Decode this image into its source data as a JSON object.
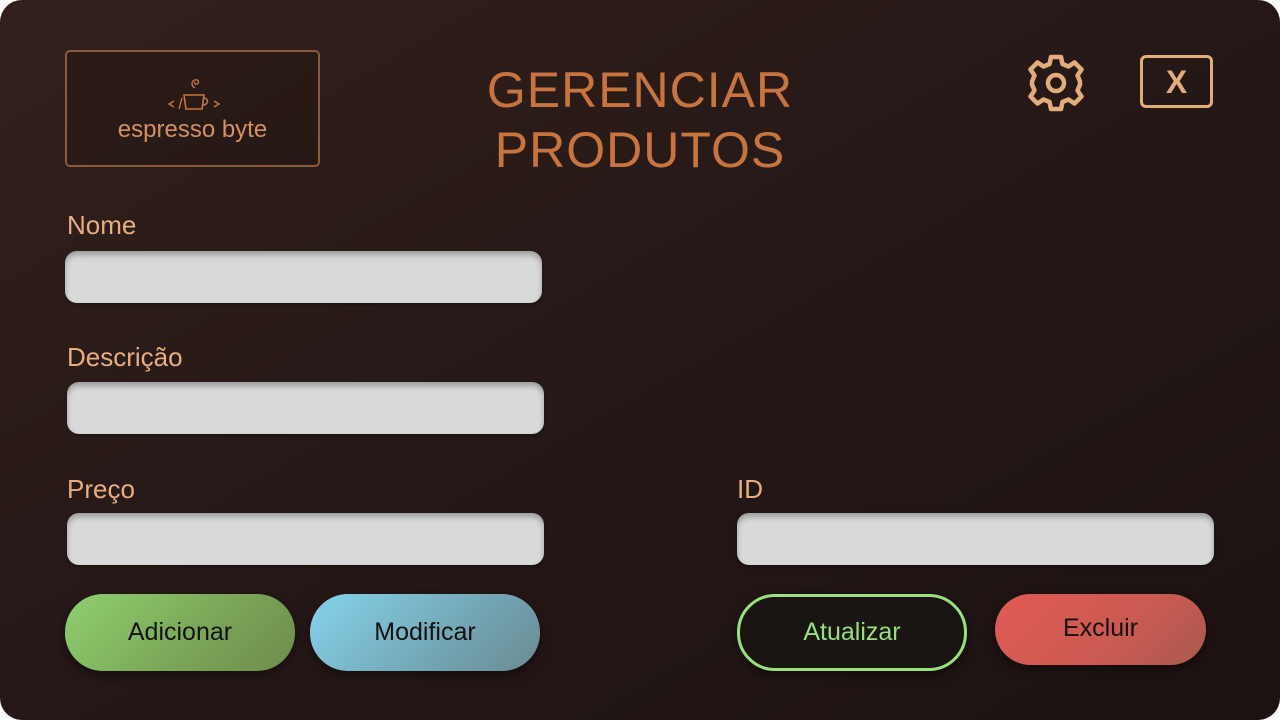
{
  "logo": {
    "text": "espresso byte",
    "icon": "coffee-code-cup-icon"
  },
  "header": {
    "title": "GERENCIAR PRODUTOS",
    "settings_icon": "gear-icon",
    "close_label": "X"
  },
  "form": {
    "nome_label": "Nome",
    "nome_value": "",
    "descricao_label": "Descrição",
    "descricao_value": "",
    "preco_label": "Preço",
    "preco_value": "",
    "id_label": "ID",
    "id_value": ""
  },
  "buttons": {
    "adicionar": "Adicionar",
    "modificar": "Modificar",
    "atualizar": "Atualizar",
    "excluir": "Excluir"
  },
  "colors": {
    "accent": "#c8743f",
    "label": "#e9ae7e",
    "add": "#8fd06e",
    "modify": "#86d3eb",
    "update": "#9be07a",
    "delete": "#e25a54"
  }
}
